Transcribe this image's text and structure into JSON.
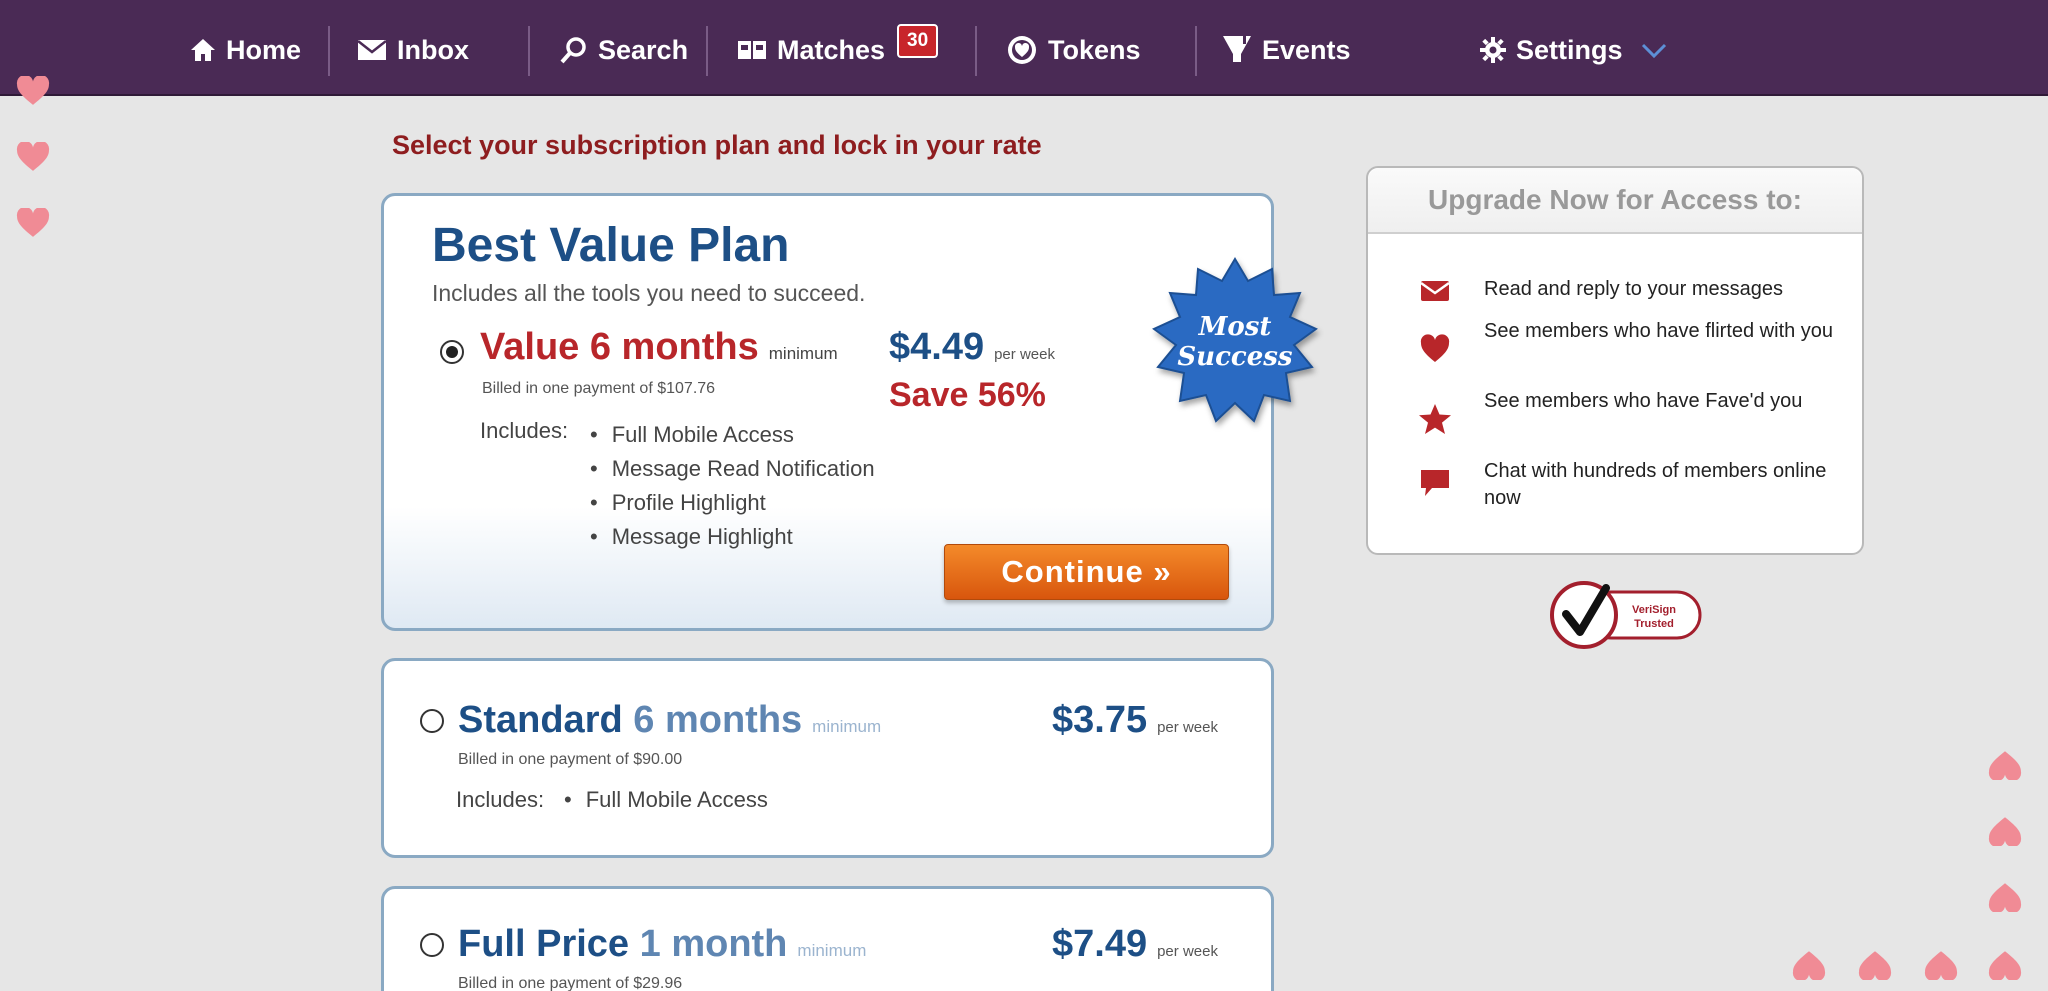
{
  "nav": {
    "items": [
      {
        "label": "Home",
        "icon": "home-icon"
      },
      {
        "label": "Inbox",
        "icon": "envelope-icon"
      },
      {
        "label": "Search",
        "icon": "search-icon"
      },
      {
        "label": "Matches",
        "icon": "matches-icon",
        "badge": "30"
      },
      {
        "label": "Tokens",
        "icon": "token-icon"
      },
      {
        "label": "Events",
        "icon": "cocktail-icon"
      },
      {
        "label": "Settings",
        "icon": "gear-icon"
      }
    ],
    "background": "#4a2a55"
  },
  "headline": "Select your subscription plan and lock in your rate",
  "best_plan": {
    "title": "Best Value Plan",
    "subtitle": "Includes all the tools you need to succeed.",
    "option_name": "Value",
    "option_term": "6 months",
    "minimum": "minimum",
    "billed": "Billed in one payment of $107.76",
    "price": "$4.49",
    "per_week": "per week",
    "save": "Save 56%",
    "includes_label": "Includes:",
    "includes": [
      "Full Mobile Access",
      "Message Read Notification",
      "Profile Highlight",
      "Message Highlight"
    ],
    "continue_label": "Continue »",
    "badge_line1": "Most",
    "badge_line2": "Success",
    "selected": true
  },
  "standard_plan": {
    "option_name": "Standard",
    "option_term": "6 months",
    "minimum": "minimum",
    "billed": "Billed in one payment of $90.00",
    "price": "$3.75",
    "per_week": "per week",
    "includes_label": "Includes:",
    "includes": [
      "Full Mobile Access"
    ],
    "selected": false
  },
  "full_plan": {
    "option_name": "Full Price",
    "option_term": "1 month",
    "minimum": "minimum",
    "billed": "Billed in one payment of $29.96",
    "price": "$7.49",
    "per_week": "per week",
    "selected": false
  },
  "sidebar": {
    "title": "Upgrade Now for Access to:",
    "items": [
      {
        "icon": "envelope-icon",
        "text": "Read and reply to your messages"
      },
      {
        "icon": "heart-icon",
        "text": "See members who have flirted with you"
      },
      {
        "icon": "star-icon",
        "text": "See members who have Fave'd you"
      },
      {
        "icon": "chat-bubble-icon",
        "text": "Chat with hundreds of members online now"
      }
    ]
  },
  "verisign": {
    "line1": "VeriSign",
    "line2": "Trusted"
  },
  "colors": {
    "accent_red": "#b8262a",
    "plan_blue": "#1d4f86",
    "continue_orange": "#e86f1b",
    "heart_pink": "#f08b95"
  }
}
